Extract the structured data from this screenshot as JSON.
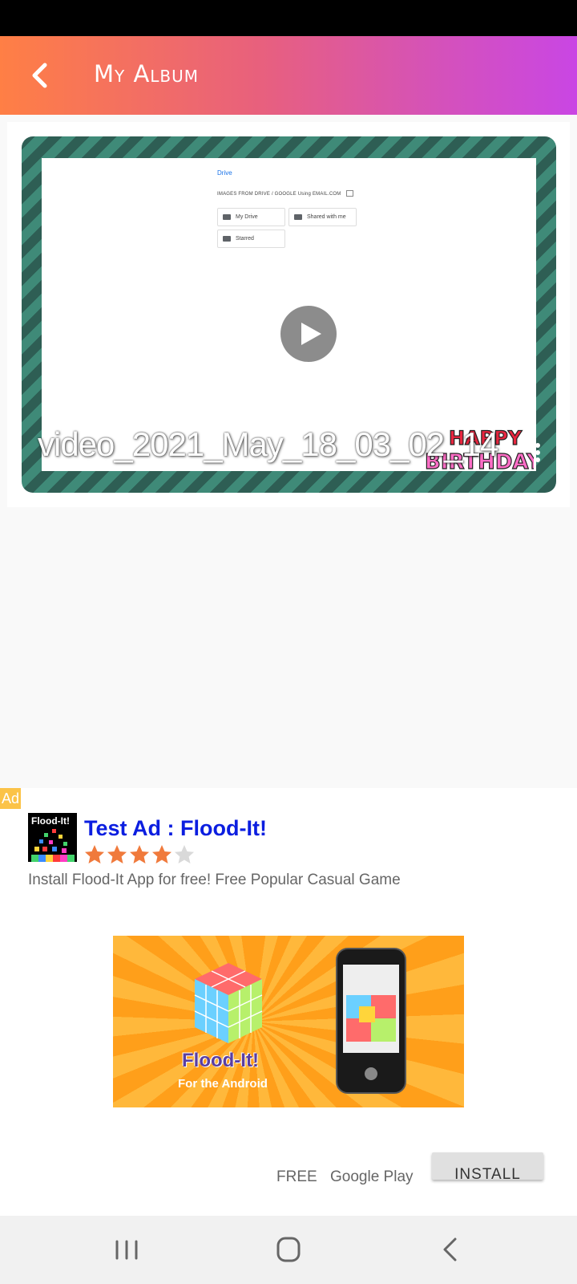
{
  "app_bar": {
    "title": "My Album"
  },
  "video": {
    "file_name": "video_2021_May_18_03_02_14",
    "preview": {
      "drive_title": "Drive",
      "path_text": "IMAGES FROM DRIVE / GOOGLE Using EMAIL.COM",
      "folders": [
        "My Drive",
        "Shared with me",
        "Starred"
      ]
    },
    "sticker": "HAPPY BIRTHDAY"
  },
  "ad": {
    "badge": "Ad",
    "icon_label": "Flood-It!",
    "title": "Test Ad : Flood-It!",
    "rating": 4,
    "rating_max": 5,
    "description": "Install Flood-It App for free! Free Popular Casual Game",
    "banner_title": "Flood-It!",
    "banner_subtitle": "For the Android",
    "price": "FREE",
    "store": "Google Play",
    "install_label": "INSTALL"
  },
  "colors": {
    "app_bar_start": "#ff7f45",
    "app_bar_end": "#c946e4",
    "ad_title": "#0b1ee0",
    "star_filled": "#f07a3c",
    "star_empty": "#d9d9d9"
  }
}
